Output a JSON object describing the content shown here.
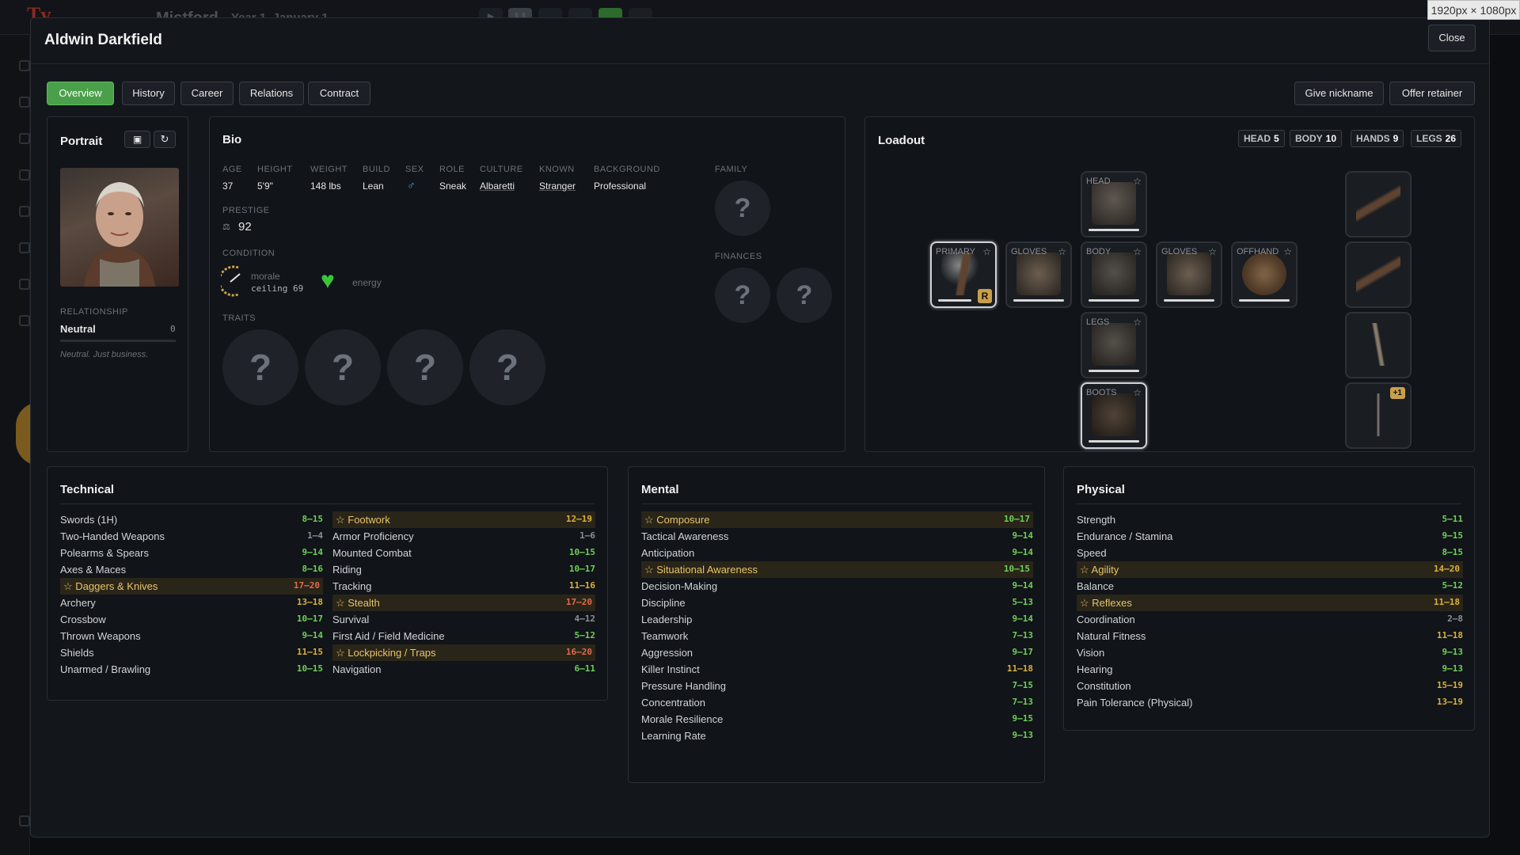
{
  "background": {
    "logo": "Tv",
    "town": "Mistford",
    "date": "Year 1, January 1"
  },
  "dimensions_label": "1920px × 1080px",
  "modal": {
    "title": "Aldwin Darkfield",
    "close_label": "Close",
    "tabs": [
      {
        "label": "Overview",
        "active": true
      },
      {
        "label": "History"
      },
      {
        "label": "Career"
      },
      {
        "label": "Relations"
      },
      {
        "label": "Contract"
      }
    ],
    "actions": {
      "nickname": "Give nickname",
      "retainer": "Offer retainer"
    }
  },
  "portrait": {
    "title": "Portrait",
    "relationship_label": "RELATIONSHIP",
    "relationship_value": "Neutral",
    "relationship_score": "0",
    "relationship_note": "Neutral. Just business."
  },
  "bio": {
    "title": "Bio",
    "fields": [
      {
        "label": "AGE",
        "value": "37"
      },
      {
        "label": "HEIGHT",
        "value": "5'9\""
      },
      {
        "label": "WEIGHT",
        "value": "148 lbs"
      },
      {
        "label": "BUILD",
        "value": "Lean"
      },
      {
        "label": "SEX",
        "value": "♂"
      },
      {
        "label": "ROLE",
        "value": "Sneak"
      },
      {
        "label": "CULTURE",
        "value": "Albaretti"
      },
      {
        "label": "KNOWN",
        "value": "Stranger"
      },
      {
        "label": "BACKGROUND",
        "value": "Professional"
      }
    ],
    "prestige_label": "PRESTIGE",
    "prestige_value": "92",
    "condition_label": "CONDITION",
    "morale_label": "morale",
    "morale_ceiling": "ceiling 69",
    "energy_label": "energy",
    "traits_label": "TRAITS",
    "family_label": "FAMILY",
    "finances_label": "FINANCES",
    "unknown": "?"
  },
  "loadout": {
    "title": "Loadout",
    "armor": [
      {
        "label": "HEAD",
        "value": "5"
      },
      {
        "label": "BODY",
        "value": "10"
      },
      {
        "label": "HANDS",
        "value": "9"
      },
      {
        "label": "LEGS",
        "value": "26"
      }
    ],
    "slots": {
      "head": "HEAD",
      "primary": "PRIMARY",
      "gloves_l": "GLOVES",
      "body": "BODY",
      "gloves_r": "GLOVES",
      "offhand": "OFFHAND",
      "legs": "LEGS",
      "boots": "BOOTS"
    },
    "primary_badge": "R",
    "extra_badge": "+1"
  },
  "technical": {
    "title": "Technical",
    "col1": [
      {
        "name": "Swords (1H)",
        "range": "8–15",
        "c": "g"
      },
      {
        "name": "Two-Handed Weapons",
        "range": "1–4",
        "c": "gr"
      },
      {
        "name": "Polearms & Spears",
        "range": "9–14",
        "c": "g"
      },
      {
        "name": "Axes & Maces",
        "range": "8–16",
        "c": "g"
      },
      {
        "name": "☆ Daggers & Knives",
        "range": "17–20",
        "c": "o",
        "star": true
      },
      {
        "name": "Archery",
        "range": "13–18",
        "c": "y"
      },
      {
        "name": "Crossbow",
        "range": "10–17",
        "c": "g"
      },
      {
        "name": "Thrown Weapons",
        "range": "9–14",
        "c": "g"
      },
      {
        "name": "Shields",
        "range": "11–15",
        "c": "y"
      },
      {
        "name": "Unarmed / Brawling",
        "range": "10–15",
        "c": "g"
      }
    ],
    "col2": [
      {
        "name": "☆ Footwork",
        "range": "12–19",
        "c": "y",
        "star": true
      },
      {
        "name": "Armor Proficiency",
        "range": "1–6",
        "c": "gr"
      },
      {
        "name": "Mounted Combat",
        "range": "10–15",
        "c": "g"
      },
      {
        "name": "Riding",
        "range": "10–17",
        "c": "g"
      },
      {
        "name": "Tracking",
        "range": "11–16",
        "c": "y"
      },
      {
        "name": "☆ Stealth",
        "range": "17–20",
        "c": "o",
        "star": true
      },
      {
        "name": "Survival",
        "range": "4–12",
        "c": "gr"
      },
      {
        "name": "First Aid / Field Medicine",
        "range": "5–12",
        "c": "g"
      },
      {
        "name": "☆ Lockpicking / Traps",
        "range": "16–20",
        "c": "o",
        "star": true
      },
      {
        "name": "Navigation",
        "range": "6–11",
        "c": "g"
      }
    ]
  },
  "mental": {
    "title": "Mental",
    "items": [
      {
        "name": "☆ Composure",
        "range": "10–17",
        "c": "g",
        "star": true
      },
      {
        "name": "Tactical Awareness",
        "range": "9–14",
        "c": "g"
      },
      {
        "name": "Anticipation",
        "range": "9–14",
        "c": "g"
      },
      {
        "name": "☆ Situational Awareness",
        "range": "10–15",
        "c": "g",
        "star": true
      },
      {
        "name": "Decision-Making",
        "range": "9–14",
        "c": "g"
      },
      {
        "name": "Discipline",
        "range": "5–13",
        "c": "g"
      },
      {
        "name": "Leadership",
        "range": "9–14",
        "c": "g"
      },
      {
        "name": "Teamwork",
        "range": "7–13",
        "c": "g"
      },
      {
        "name": "Aggression",
        "range": "9–17",
        "c": "g"
      },
      {
        "name": "Killer Instinct",
        "range": "11–18",
        "c": "y"
      },
      {
        "name": "Pressure Handling",
        "range": "7–15",
        "c": "g"
      },
      {
        "name": "Concentration",
        "range": "7–13",
        "c": "g"
      },
      {
        "name": "Morale Resilience",
        "range": "9–15",
        "c": "g"
      },
      {
        "name": "Learning Rate",
        "range": "9–13",
        "c": "g"
      }
    ]
  },
  "physical": {
    "title": "Physical",
    "items": [
      {
        "name": "Strength",
        "range": "5–11",
        "c": "g"
      },
      {
        "name": "Endurance / Stamina",
        "range": "9–15",
        "c": "g"
      },
      {
        "name": "Speed",
        "range": "8–15",
        "c": "g"
      },
      {
        "name": "☆ Agility",
        "range": "14–20",
        "c": "y",
        "star": true
      },
      {
        "name": "Balance",
        "range": "5–12",
        "c": "g"
      },
      {
        "name": "☆ Reflexes",
        "range": "11–18",
        "c": "y",
        "star": true
      },
      {
        "name": "Coordination",
        "range": "2–8",
        "c": "gr"
      },
      {
        "name": "Natural Fitness",
        "range": "11–18",
        "c": "y"
      },
      {
        "name": "Vision",
        "range": "9–13",
        "c": "g"
      },
      {
        "name": "Hearing",
        "range": "9–13",
        "c": "g"
      },
      {
        "name": "Constitution",
        "range": "15–19",
        "c": "y"
      },
      {
        "name": "Pain Tolerance (Physical)",
        "range": "13–19",
        "c": "y"
      }
    ]
  }
}
